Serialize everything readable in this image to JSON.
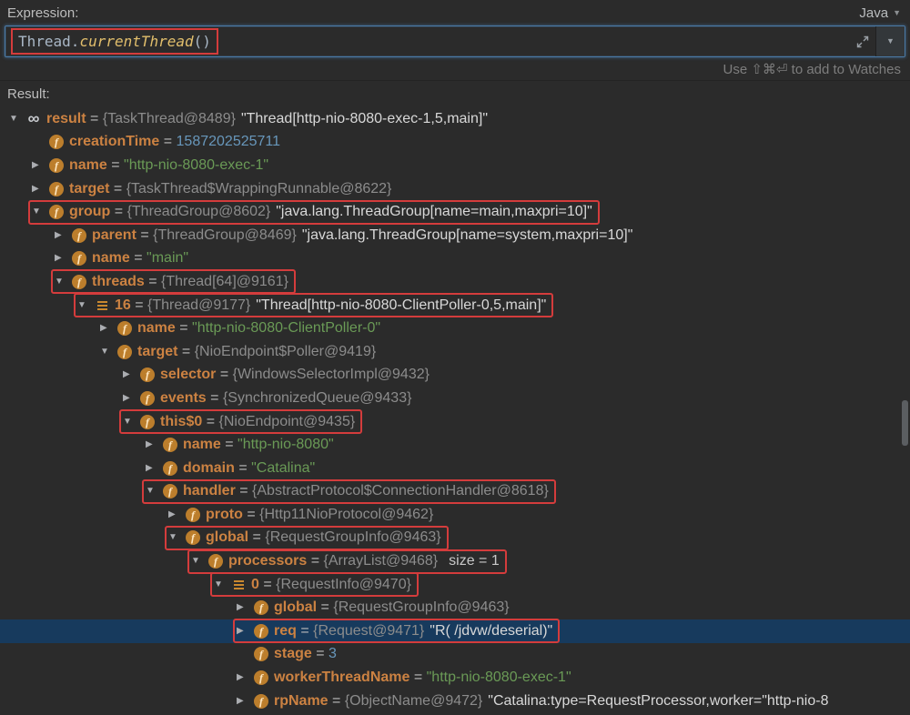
{
  "expression_panel": {
    "label": "Expression:",
    "language_selector": {
      "label": "Java"
    },
    "input": {
      "tokens": [
        {
          "text": "Thread",
          "style": "plain"
        },
        {
          "text": ".",
          "style": "plain"
        },
        {
          "text": "currentThread",
          "style": "method"
        },
        {
          "text": "()",
          "style": "plain"
        }
      ]
    },
    "hint": "Use ⇧⌘⏎ to add to Watches"
  },
  "result_panel": {
    "label": "Result:",
    "rows": [
      {
        "indent": 0,
        "arrow": "expanded",
        "icon": "result",
        "name": "result",
        "ref": "{TaskThread@8489}",
        "tostring": "\"Thread[http-nio-8080-exec-1,5,main]\""
      },
      {
        "indent": 1,
        "arrow": "none",
        "icon": "field",
        "name": "creationTime",
        "number": "1587202525711"
      },
      {
        "indent": 1,
        "arrow": "collapsed",
        "icon": "field",
        "name": "name",
        "string": "\"http-nio-8080-exec-1\""
      },
      {
        "indent": 1,
        "arrow": "collapsed",
        "icon": "field",
        "name": "target",
        "ref": "{TaskThread$WrappingRunnable@8622}"
      },
      {
        "indent": 1,
        "arrow": "expanded",
        "icon": "field",
        "name": "group",
        "ref": "{ThreadGroup@8602}",
        "tostring": "\"java.lang.ThreadGroup[name=main,maxpri=10]\"",
        "boxed": true
      },
      {
        "indent": 2,
        "arrow": "collapsed",
        "icon": "field",
        "name": "parent",
        "ref": "{ThreadGroup@8469}",
        "tostring": "\"java.lang.ThreadGroup[name=system,maxpri=10]\""
      },
      {
        "indent": 2,
        "arrow": "collapsed",
        "icon": "field",
        "name": "name",
        "string": "\"main\""
      },
      {
        "indent": 2,
        "arrow": "expanded",
        "icon": "field",
        "name": "threads",
        "ref": "{Thread[64]@9161}",
        "boxed": true
      },
      {
        "indent": 3,
        "arrow": "expanded",
        "icon": "array-item",
        "name": "16",
        "ref": "{Thread@9177}",
        "tostring": "\"Thread[http-nio-8080-ClientPoller-0,5,main]\"",
        "boxed": true
      },
      {
        "indent": 4,
        "arrow": "collapsed",
        "icon": "field",
        "name": "name",
        "string": "\"http-nio-8080-ClientPoller-0\""
      },
      {
        "indent": 4,
        "arrow": "expanded",
        "icon": "field",
        "name": "target",
        "ref": "{NioEndpoint$Poller@9419}"
      },
      {
        "indent": 5,
        "arrow": "collapsed",
        "icon": "field",
        "name": "selector",
        "ref": "{WindowsSelectorImpl@9432}"
      },
      {
        "indent": 5,
        "arrow": "collapsed",
        "icon": "field",
        "name": "events",
        "ref": "{SynchronizedQueue@9433}"
      },
      {
        "indent": 5,
        "arrow": "expanded",
        "icon": "field",
        "name": "this$0",
        "ref": "{NioEndpoint@9435}",
        "boxed": true
      },
      {
        "indent": 6,
        "arrow": "collapsed",
        "icon": "field",
        "name": "name",
        "string": "\"http-nio-8080\""
      },
      {
        "indent": 6,
        "arrow": "collapsed",
        "icon": "field",
        "name": "domain",
        "string": "\"Catalina\""
      },
      {
        "indent": 6,
        "arrow": "expanded",
        "icon": "field",
        "name": "handler",
        "ref": "{AbstractProtocol$ConnectionHandler@8618}",
        "boxed": true
      },
      {
        "indent": 7,
        "arrow": "collapsed",
        "icon": "field",
        "name": "proto",
        "ref": "{Http11NioProtocol@9462}"
      },
      {
        "indent": 7,
        "arrow": "expanded",
        "icon": "field",
        "name": "global",
        "ref": "{RequestGroupInfo@9463}",
        "boxed": true
      },
      {
        "indent": 8,
        "arrow": "expanded",
        "icon": "field",
        "name": "processors",
        "ref": "{ArrayList@9468}",
        "size": "size = 1",
        "boxed": true
      },
      {
        "indent": 9,
        "arrow": "expanded",
        "icon": "array-item",
        "name": "0",
        "ref": "{RequestInfo@9470}",
        "boxed": true
      },
      {
        "indent": 10,
        "arrow": "collapsed",
        "icon": "field",
        "name": "global",
        "ref": "{RequestGroupInfo@9463}"
      },
      {
        "indent": 10,
        "arrow": "collapsed",
        "icon": "field",
        "name": "req",
        "ref": "{Request@9471}",
        "tostring": "\"R( /jdvw/deserial)\"",
        "boxed": true,
        "selected": true
      },
      {
        "indent": 10,
        "arrow": "none",
        "icon": "field",
        "name": "stage",
        "number": "3"
      },
      {
        "indent": 10,
        "arrow": "collapsed",
        "icon": "field",
        "name": "workerThreadName",
        "string": "\"http-nio-8080-exec-1\""
      },
      {
        "indent": 10,
        "arrow": "collapsed",
        "icon": "field",
        "name": "rpName",
        "ref": "{ObjectName@9472}",
        "tostring": "\"Catalina:type=RequestProcessor,worker=\"http-nio-8"
      }
    ]
  },
  "colors": {
    "background": "#2b2b2b",
    "selection_row": "#173a5d",
    "annotation_red": "#d43c3c",
    "name_orange": "#cc8242",
    "string_green": "#6a9a56",
    "reference_gray": "#8c8c8c",
    "number_blue": "#6897bb",
    "tostring_white": "#d8d8d8",
    "focus_border_blue": "#4a7ba8",
    "field_icon_orange": "#bc7e2c"
  }
}
